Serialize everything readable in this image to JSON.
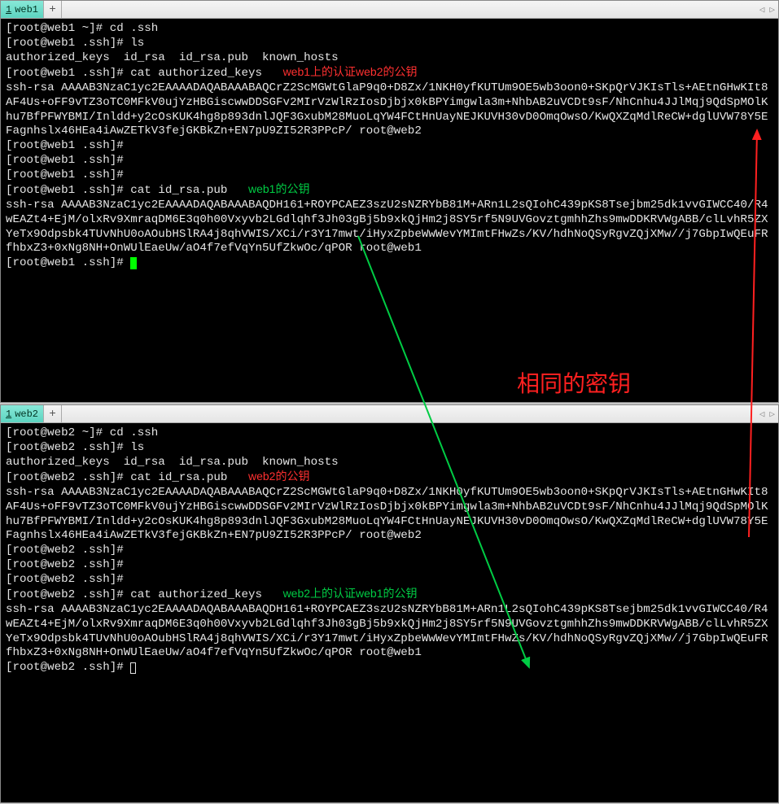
{
  "top_pane": {
    "tab_index": "1",
    "tab_label": "web1",
    "newtab_glyph": "+",
    "nav_left": "◁",
    "nav_right": "▷",
    "lines": [
      "[root@web1 ~]# cd .ssh",
      "[root@web1 .ssh]# ls",
      "authorized_keys  id_rsa  id_rsa.pub  known_hosts",
      "[root@web1 .ssh]# cat authorized_keys",
      "ssh-rsa AAAAB3NzaC1yc2EAAAADAQABAAABAQCrZ2ScMGWtGlaP9q0+D8Zx/1NKH0yfKUTUm9OE5wb3oon0+SKpQrVJKIsTls+AEtnGHwKIt8AF4Us+oFF9vTZ3oTC0MFkV0ujYzHBGiscwwDDSGFv2MIrVzWlRzIosDjbjx0kBPYimgwla3m+NhbAB2uVCDt9sF/NhCnhu4JJlMqj9QdSpMOlKhu7BfPFWYBMI/Inldd+y2cOsKUK4hg8p893dnlJQF3GxubM28MuoLqYW4FCtHnUayNEJKUVH30vD0OmqOwsO/KwQXZqMdlReCW+dglUVW78Y5EFagnhslx46HEa4iAwZETkV3fejGKBkZn+EN7pU9ZI52R3PPcP/ root@web2",
      "[root@web1 .ssh]# ",
      "[root@web1 .ssh]# ",
      "[root@web1 .ssh]# ",
      "[root@web1 .ssh]# cat id_rsa.pub",
      "ssh-rsa AAAAB3NzaC1yc2EAAAADAQABAAABAQDH161+ROYPCAEZ3szU2sNZRYbB81M+ARn1L2sQIohC439pKS8Tsejbm25dk1vvGIWCC40/R4wEAZt4+EjM/olxRv9XmraqDM6E3q0h00Vxyvb2LGdlqhf3Jh03gBj5b9xkQjHm2j8SY5rf5N9UVGovztgmhhZhs9mwDDKRVWgABB/clLvhR5ZXYeTx9Odpsbk4TUvNhU0oAOubHSlRA4j8qhVWIS/XCi/r3Y17mwt/iHyxZpbeWwWevYMImtFHwZs/KV/hdhNoQSyRgvZQjXMw//j7GbpIwQEuFRfhbxZ3+0xNg8NH+OnWUlEaeUw/aO4f7efVqYn5UfZkwOc/qPOR root@web1",
      "[root@web1 .ssh]# "
    ],
    "annotation1": "web1上的认证web2的公钥",
    "annotation2": "web1的公钥"
  },
  "bottom_pane": {
    "tab_index": "1",
    "tab_label": "web2",
    "newtab_glyph": "+",
    "nav_left": "◁",
    "nav_right": "▷",
    "lines": [
      "[root@web2 ~]# cd .ssh",
      "[root@web2 .ssh]# ls",
      "authorized_keys  id_rsa  id_rsa.pub  known_hosts",
      "[root@web2 .ssh]# cat id_rsa.pub",
      "ssh-rsa AAAAB3NzaC1yc2EAAAADAQABAAABAQCrZ2ScMGWtGlaP9q0+D8Zx/1NKH0yfKUTUm9OE5wb3oon0+SKpQrVJKIsTls+AEtnGHwKIt8AF4Us+oFF9vTZ3oTC0MFkV0ujYzHBGiscwwDDSGFv2MIrVzWlRzIosDjbjx0kBPYimgwla3m+NhbAB2uVCDt9sF/NhCnhu4JJlMqj9QdSpMOlKhu7BfPFWYBMI/Inldd+y2cOsKUK4hg8p893dnlJQF3GxubM28MuoLqYW4FCtHnUayNEJKUVH30vD0OmqOwsO/KwQXZqMdlReCW+dglUVW78Y5EFagnhslx46HEa4iAwZETkV3fejGKBkZn+EN7pU9ZI52R3PPcP/ root@web2",
      "[root@web2 .ssh]# ",
      "[root@web2 .ssh]# ",
      "[root@web2 .ssh]# ",
      "[root@web2 .ssh]# cat authorized_keys",
      "ssh-rsa AAAAB3NzaC1yc2EAAAADAQABAAABAQDH161+ROYPCAEZ3szU2sNZRYbB81M+ARn1L2sQIohC439pKS8Tsejbm25dk1vvGIWCC40/R4wEAZt4+EjM/olxRv9XmraqDM6E3q0h00Vxyvb2LGdlqhf3Jh03gBj5b9xkQjHm2j8SY5rf5N9UVGovztgmhhZhs9mwDDKRVWgABB/clLvhR5ZXYeTx9Odpsbk4TUvNhU0oAOubHSlRA4j8qhVWIS/XCi/r3Y17mwt/iHyxZpbeWwWevYMImtFHwZs/KV/hdhNoQSyRgvZQjXMw//j7GbpIwQEuFRfhbxZ3+0xNg8NH+OnWUlEaeUw/aO4f7efVqYn5UfZkwOc/qPOR root@web1",
      "[root@web2 .ssh]# "
    ],
    "annotation1": "web2的公钥",
    "annotation2": "web2上的认证web1的公钥"
  },
  "center_annotation": "相同的密钥"
}
